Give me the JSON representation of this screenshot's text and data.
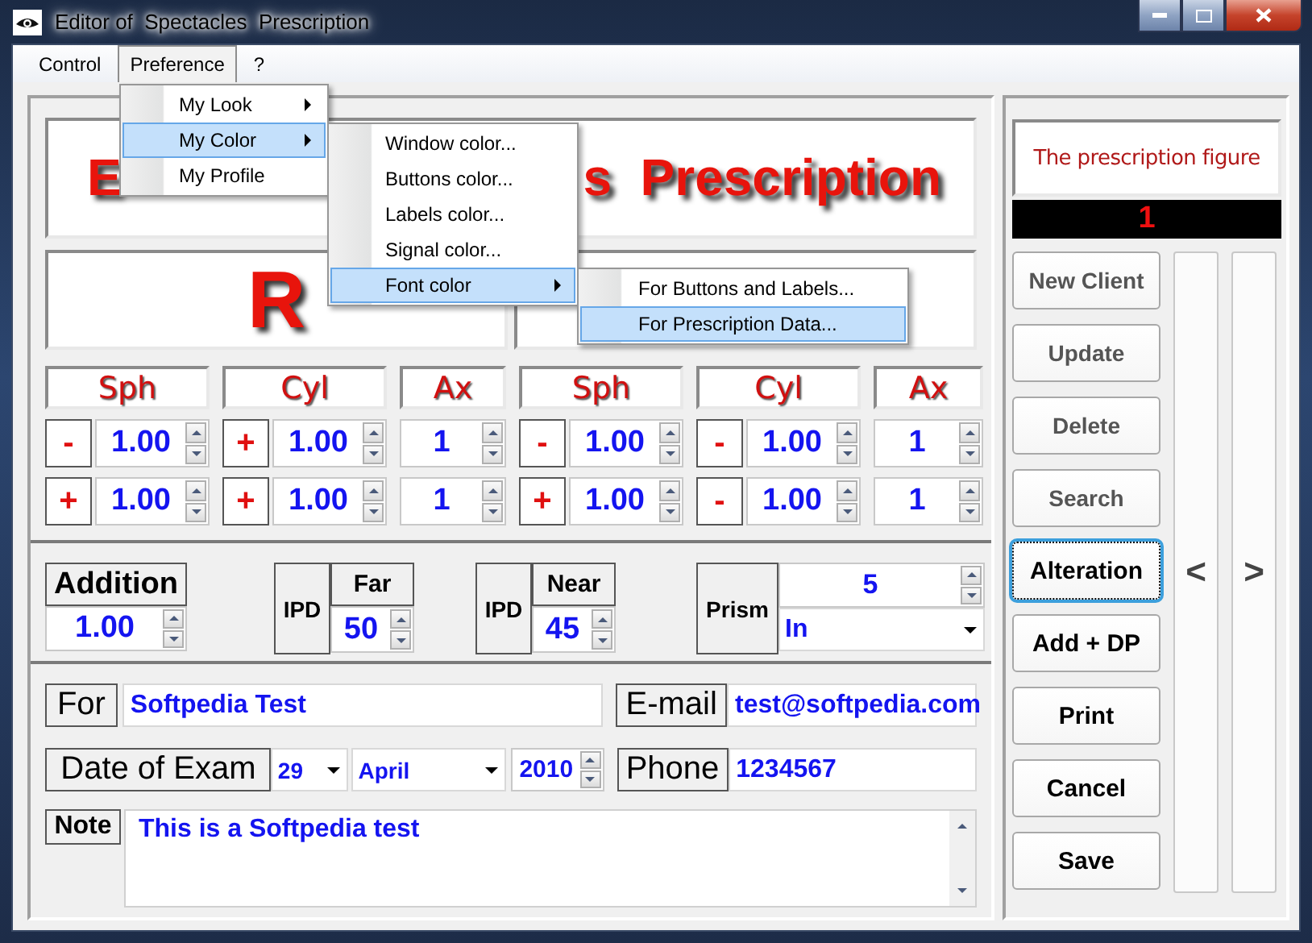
{
  "window": {
    "title": "Editor of  Spectacles  Prescription"
  },
  "menu_bar": [
    {
      "label": "Control",
      "selected": false
    },
    {
      "label": "Preference",
      "selected": true
    },
    {
      "label": "?",
      "selected": false
    }
  ],
  "preference_menu": [
    {
      "label": "My Look",
      "submenu": true,
      "selected": false
    },
    {
      "label": "My Color",
      "submenu": true,
      "selected": true
    },
    {
      "label": "My Profile",
      "submenu": false,
      "selected": false
    }
  ],
  "color_menu": [
    {
      "label": "Window color...",
      "submenu": false,
      "selected": false
    },
    {
      "label": "Buttons color...",
      "submenu": false,
      "selected": false
    },
    {
      "label": "Labels color...",
      "submenu": false,
      "selected": false
    },
    {
      "label": "Signal color...",
      "submenu": false,
      "selected": false
    },
    {
      "label": "Font color",
      "submenu": true,
      "selected": true
    }
  ],
  "font_color_menu": [
    {
      "label": "For Buttons and Labels...",
      "submenu": false,
      "selected": false
    },
    {
      "label": "For Prescription Data...",
      "submenu": false,
      "selected": true
    }
  ],
  "header": {
    "title_parts": [
      "E",
      "s  Prescription"
    ]
  },
  "eye": {
    "label": "R"
  },
  "prescription": {
    "columns": [
      "Sph",
      "Cyl",
      "Ax",
      "Sph",
      "Cyl",
      "Ax"
    ],
    "rows": [
      [
        {
          "kind": "signed",
          "sign": "-",
          "value": "1.00"
        },
        {
          "kind": "signed",
          "sign": "+",
          "value": "1.00"
        },
        {
          "kind": "axis",
          "value": "1"
        },
        {
          "kind": "signed",
          "sign": "-",
          "value": "1.00"
        },
        {
          "kind": "signed",
          "sign": "-",
          "value": "1.00"
        },
        {
          "kind": "axis",
          "value": "1"
        }
      ],
      [
        {
          "kind": "signed",
          "sign": "+",
          "value": "1.00"
        },
        {
          "kind": "signed",
          "sign": "+",
          "value": "1.00"
        },
        {
          "kind": "axis",
          "value": "1"
        },
        {
          "kind": "signed",
          "sign": "+",
          "value": "1.00"
        },
        {
          "kind": "signed",
          "sign": "-",
          "value": "1.00"
        },
        {
          "kind": "axis",
          "value": "1"
        }
      ]
    ]
  },
  "addition": {
    "label": "Addition",
    "value": "1.00"
  },
  "ipd": [
    {
      "label": "IPD",
      "sublabel": "Far",
      "value": "50"
    },
    {
      "label": "IPD",
      "sublabel": "Near",
      "value": "45"
    }
  ],
  "prism": {
    "label": "Prism",
    "value": "5",
    "direction": "In"
  },
  "client": {
    "for_label": "For",
    "name": "Softpedia Test",
    "email_label": "E-mail",
    "email": "test@softpedia.com",
    "date_label": "Date of Exam",
    "day": "29",
    "month": "April",
    "year": "2010",
    "phone_label": "Phone",
    "phone": "1234567",
    "note_label": "Note",
    "note": "This is a Softpedia test"
  },
  "side_panel": {
    "figure_label": "The prescription figure",
    "figure_number": "1",
    "buttons": [
      {
        "label": "New Client",
        "disabled": true,
        "focused": false
      },
      {
        "label": "Update",
        "disabled": true,
        "focused": false
      },
      {
        "label": "Delete",
        "disabled": true,
        "focused": false
      },
      {
        "label": "Search",
        "disabled": true,
        "focused": false
      },
      {
        "label": "Alteration",
        "disabled": false,
        "focused": true
      },
      {
        "label": "Add + DP",
        "disabled": false,
        "focused": false
      },
      {
        "label": "Print",
        "disabled": false,
        "focused": false
      },
      {
        "label": "Cancel",
        "disabled": false,
        "focused": false
      },
      {
        "label": "Save",
        "disabled": false,
        "focused": false
      }
    ],
    "nav": [
      "<",
      ">"
    ]
  }
}
